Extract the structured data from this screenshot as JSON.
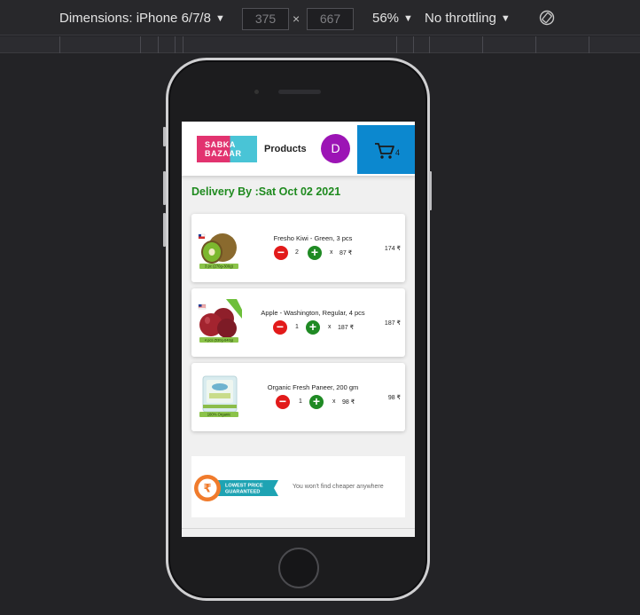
{
  "devtools": {
    "device_label": "Dimensions: iPhone 6/7/8",
    "width": "375",
    "height": "667",
    "times": "×",
    "zoom": "56%",
    "throttling": "No throttling",
    "caret": "▼"
  },
  "app": {
    "logo_line1": "SABKA",
    "logo_line2": "BAZAAR",
    "nav_products": "Products",
    "avatar_initial": "D",
    "cart_count": "4",
    "delivery": "Delivery By :Sat Oct 02 2021",
    "minus_symbol": "−",
    "plus_symbol": "+",
    "times": "x",
    "items": [
      {
        "name": "Fresho Kiwi - Green, 3 pcs",
        "qty": "2",
        "unit_price": "87 ₹",
        "total": "174 ₹",
        "badge": "3 pc (270g-300g)"
      },
      {
        "name": "Apple - Washington, Regular, 4 pcs",
        "qty": "1",
        "unit_price": "187 ₹",
        "total": "187 ₹",
        "badge": "4 pcs (530g-640g)"
      },
      {
        "name": "Organic Fresh Paneer, 200 gm",
        "qty": "1",
        "unit_price": "98 ₹",
        "total": "98 ₹",
        "badge": "100% Organic"
      }
    ],
    "promo_badge_line1": "LOWEST PRICE",
    "promo_badge_line2": "GUARANTEED",
    "promo_text": "You won't find cheaper anywhere"
  },
  "colors": {
    "avatar": "#9c14b5",
    "cart_bg": "#0c88cf",
    "delivery_text": "#1e8a1e",
    "minus": "#e21a1a",
    "plus": "#1f8a24"
  }
}
